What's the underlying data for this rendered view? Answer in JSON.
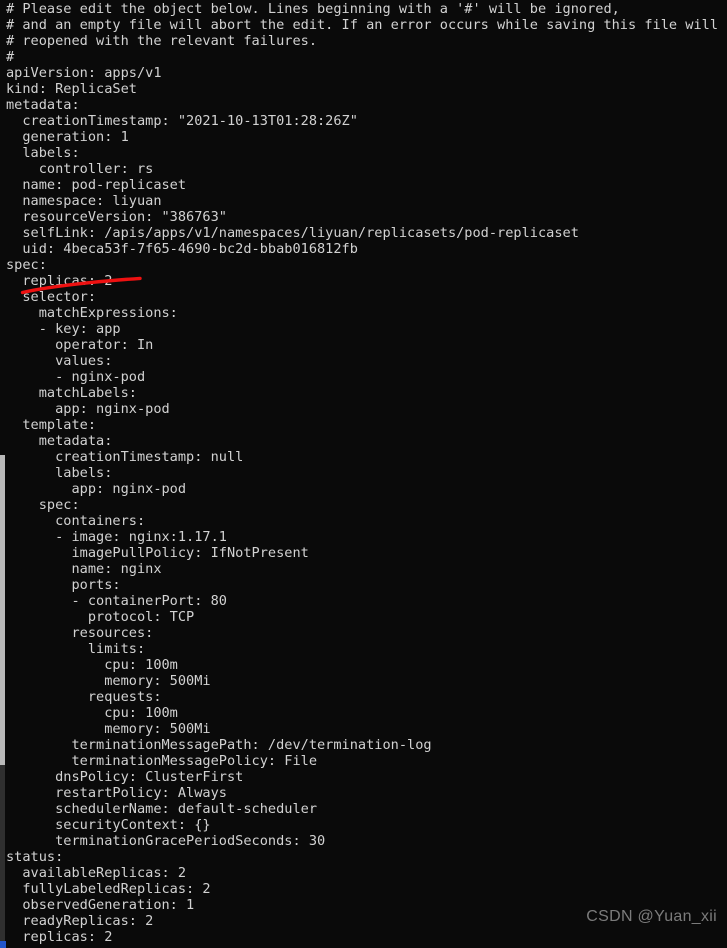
{
  "window": {
    "kind": "terminal-text-editor",
    "background_color": "#0a0a0a",
    "text_color": "#d2d2d2"
  },
  "scrollbar": {
    "position": "left",
    "thumb_color": "#b9b9b9",
    "track_color": "#2f2f2f",
    "caret_color": "#2255cc"
  },
  "annotation": {
    "color": "#ee1111",
    "target_line": "  replicas: 2",
    "description": "red-underline-stroke"
  },
  "watermark": {
    "text": "CSDN @Yuan_xii",
    "color": "#8f8f8f"
  },
  "editor": {
    "lines": [
      "# Please edit the object below. Lines beginning with a '#' will be ignored,",
      "# and an empty file will abort the edit. If an error occurs while saving this file will be",
      "# reopened with the relevant failures.",
      "#",
      "apiVersion: apps/v1",
      "kind: ReplicaSet",
      "metadata:",
      "  creationTimestamp: \"2021-10-13T01:28:26Z\"",
      "  generation: 1",
      "  labels:",
      "    controller: rs",
      "  name: pod-replicaset",
      "  namespace: liyuan",
      "  resourceVersion: \"386763\"",
      "  selfLink: /apis/apps/v1/namespaces/liyuan/replicasets/pod-replicaset",
      "  uid: 4beca53f-7f65-4690-bc2d-bbab016812fb",
      "spec:",
      "  replicas: 2",
      "  selector:",
      "    matchExpressions:",
      "    - key: app",
      "      operator: In",
      "      values:",
      "      - nginx-pod",
      "    matchLabels:",
      "      app: nginx-pod",
      "  template:",
      "    metadata:",
      "      creationTimestamp: null",
      "      labels:",
      "        app: nginx-pod",
      "    spec:",
      "      containers:",
      "      - image: nginx:1.17.1",
      "        imagePullPolicy: IfNotPresent",
      "        name: nginx",
      "        ports:",
      "        - containerPort: 80",
      "          protocol: TCP",
      "        resources:",
      "          limits:",
      "            cpu: 100m",
      "            memory: 500Mi",
      "          requests:",
      "            cpu: 100m",
      "            memory: 500Mi",
      "        terminationMessagePath: /dev/termination-log",
      "        terminationMessagePolicy: File",
      "      dnsPolicy: ClusterFirst",
      "      restartPolicy: Always",
      "      schedulerName: default-scheduler",
      "      securityContext: {}",
      "      terminationGracePeriodSeconds: 30",
      "status:",
      "  availableReplicas: 2",
      "  fullyLabeledReplicas: 2",
      "  observedGeneration: 1",
      "  readyReplicas: 2",
      "  replicas: 2"
    ]
  }
}
